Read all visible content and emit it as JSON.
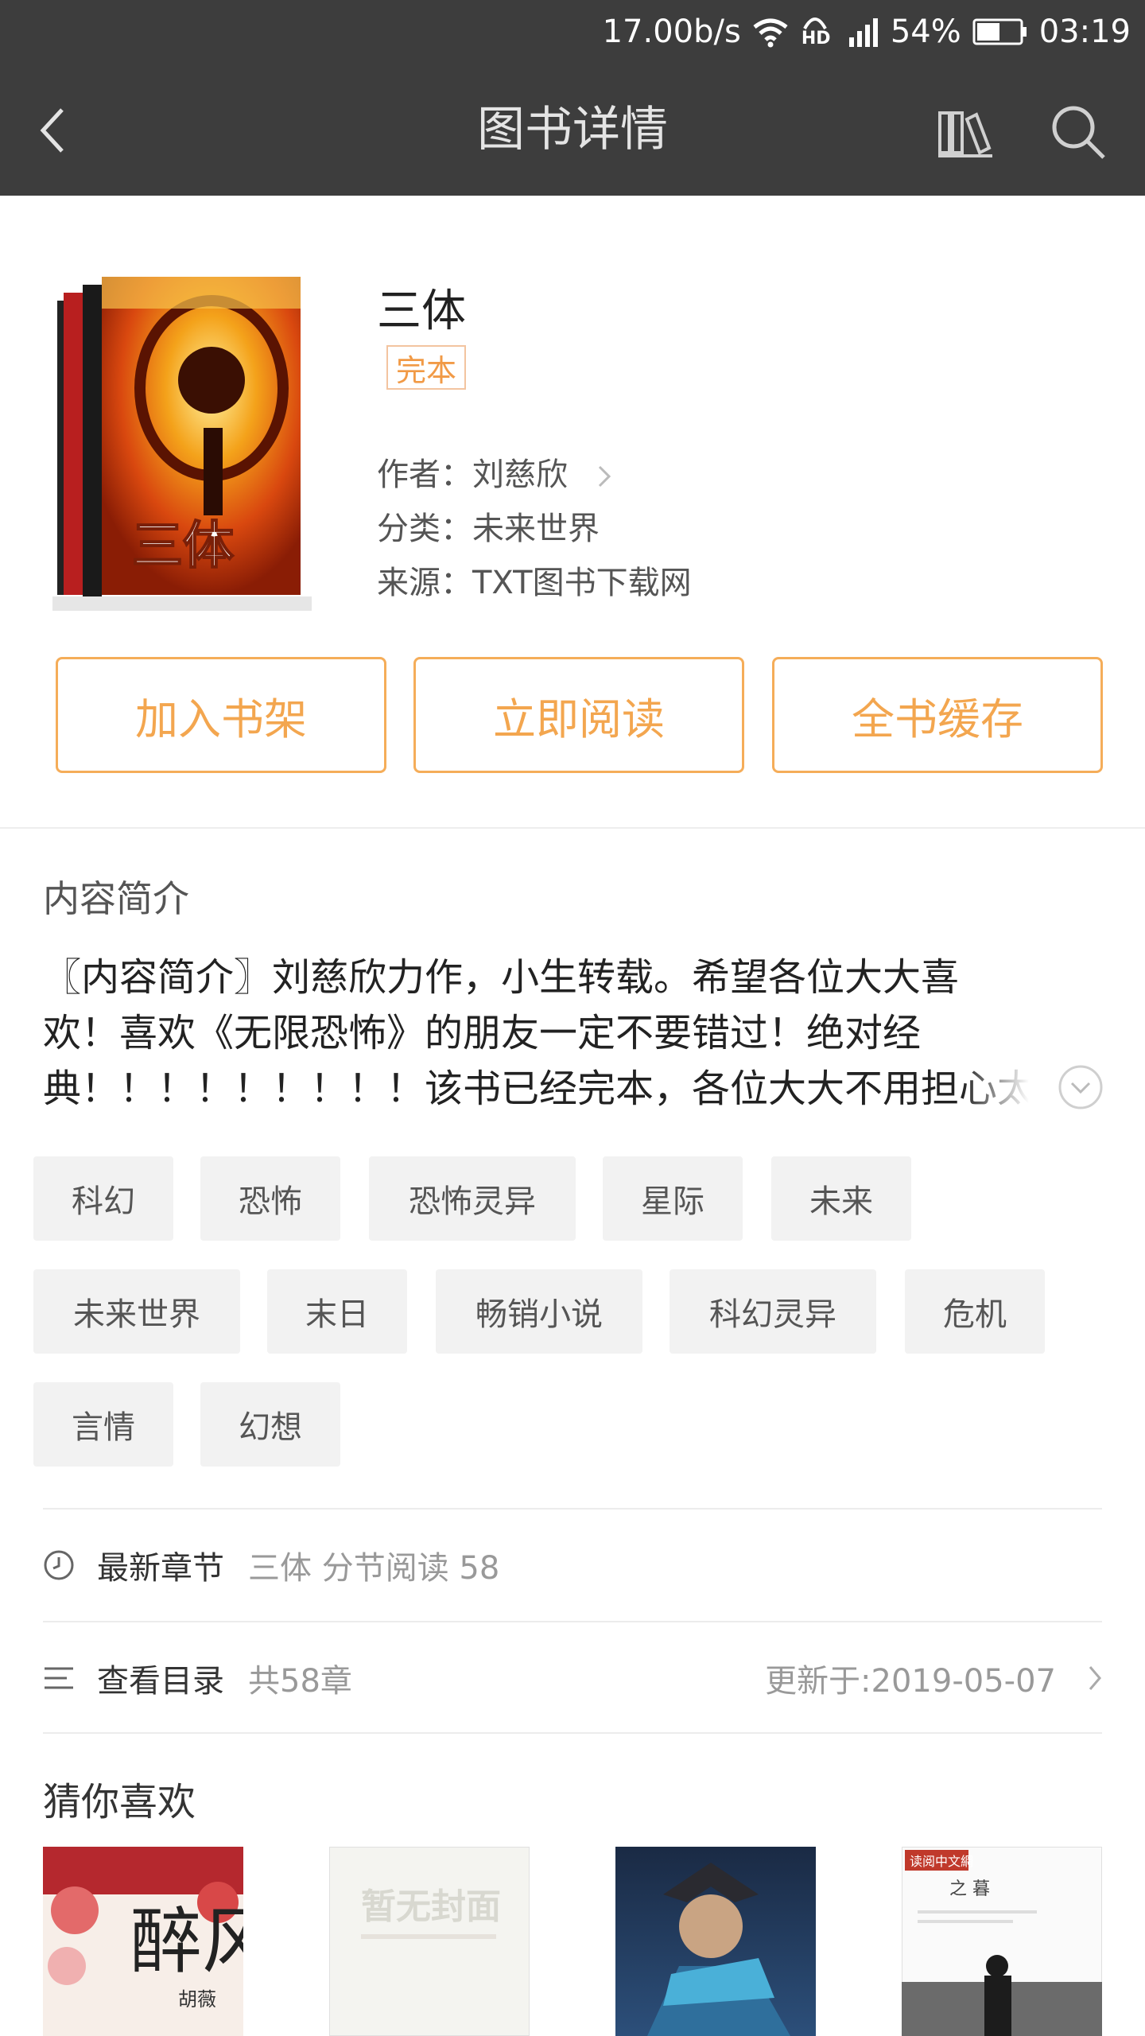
{
  "status_bar": {
    "speed": "17.00b/s",
    "network_badge": "HD",
    "battery": "54%",
    "time": "03:19"
  },
  "app_bar": {
    "title": "图书详情"
  },
  "book": {
    "title": "三体",
    "status_badge": "完本",
    "cover_text": "三体",
    "author_key": "作者：",
    "author": "刘慈欣",
    "category_key": "分类：",
    "category": "未来世界",
    "source_key": "来源：",
    "source": "TXT图书下载网"
  },
  "actions": {
    "add_shelf": "加入书架",
    "read_now": "立即阅读",
    "cache_all": "全书缓存"
  },
  "intro": {
    "heading": "内容简介",
    "lines": [
      "〖内容简介〗刘慈欣力作，小生转载。希望各位大大喜",
      "欢！喜欢《无限恐怖》的朋友一定不要错过！绝对经",
      "典！！！！！！！！！该书已经完本，各位大大不用担心太"
    ]
  },
  "tags": [
    "科幻",
    "恐怖",
    "恐怖灵异",
    "星际",
    "未来",
    "未来世界",
    "末日",
    "畅销小说",
    "科幻灵异",
    "危机",
    "言情",
    "幻想"
  ],
  "latest_chapter": {
    "label": "最新章节",
    "value": "三体 分节阅读 58"
  },
  "catalog": {
    "label": "查看目录",
    "count": "共58章",
    "updated": "更新于:2019-05-07"
  },
  "recommend": {
    "heading": "猜你喜欢",
    "placeholder_text": "暂无封面",
    "cover1_text": "醉风",
    "cover1_author": "胡薇",
    "cover4_header": "读阅中文網",
    "cover4_title": "之 暮"
  },
  "colors": {
    "accent": "#f3a64f",
    "bar": "#3d3d3d",
    "tag_bg": "#f2f2f2"
  }
}
